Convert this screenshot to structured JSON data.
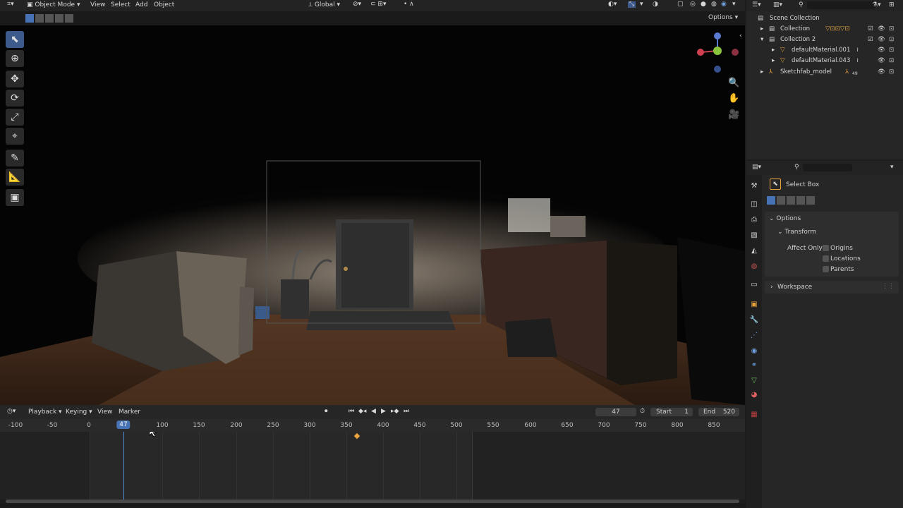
{
  "header": {
    "mode": "Object Mode",
    "menus": [
      "View",
      "Select",
      "Add",
      "Object"
    ],
    "transform_orientation": "Global",
    "options_label": "Options"
  },
  "timeline": {
    "menus": [
      "Playback",
      "Keying",
      "View",
      "Marker"
    ],
    "current_frame": "47",
    "start_label": "Start",
    "start_value": "1",
    "end_label": "End",
    "end_value": "520",
    "ticks": [
      "-100",
      "-50",
      "0",
      "47",
      "100",
      "150",
      "200",
      "250",
      "300",
      "350",
      "400",
      "450",
      "500",
      "550",
      "600",
      "650",
      "700",
      "750",
      "800",
      "850"
    ],
    "keyframe_at": 365
  },
  "outliner": {
    "root": "Scene Collection",
    "items": [
      {
        "label": "Collection",
        "depth": 1
      },
      {
        "label": "Collection 2",
        "depth": 1
      },
      {
        "label": "defaultMaterial.001",
        "depth": 2
      },
      {
        "label": "defaultMaterial.043",
        "depth": 2
      },
      {
        "label": "Sketchfab_model",
        "depth": 1
      }
    ],
    "sketchfab_badge": "49"
  },
  "properties": {
    "tool_name": "Select Box",
    "options_label": "Options",
    "transform_label": "Transform",
    "affect_only_label": "Affect Only",
    "checkboxes": [
      "Origins",
      "Locations",
      "Parents"
    ],
    "workspace_label": "Workspace"
  },
  "colors": {
    "accent": "#4772b3",
    "keyframe": "#e8a33d",
    "playhead": "#4f8fd6"
  }
}
